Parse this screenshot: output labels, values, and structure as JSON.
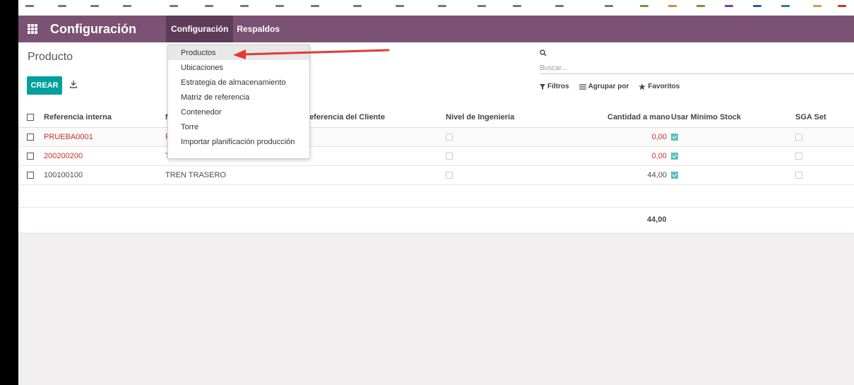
{
  "navbar": {
    "app_title": "Configuración",
    "menu": [
      {
        "label": "Configuración",
        "active": true
      },
      {
        "label": "Respaldos",
        "active": false
      }
    ],
    "background": "#7c5274"
  },
  "control_panel": {
    "title": "Producto",
    "create_label": "CREAR",
    "search_placeholder": "Buscar...",
    "filters_label": "Filtros",
    "group_by_label": "Agrupar por",
    "favorites_label": "Favoritos"
  },
  "dropdown": {
    "items": [
      "Productos",
      "Ubicaciones",
      "Estrategia de almacenamiento",
      "Matriz de referencia",
      "Contenedor",
      "Torre",
      "Importar planificación producción"
    ],
    "highlighted": "Productos"
  },
  "table": {
    "headers": [
      "Referencia interna",
      "N",
      "Referencia del Cliente",
      "Nivel de Ingeniería",
      "Cantidad a mano",
      "Usar Mínimo Stock",
      "SGA Set"
    ],
    "rows": [
      {
        "ref": "PRUEBA0001",
        "name": "P",
        "qty": "0,00",
        "min_stock": true,
        "sga": false,
        "red": true
      },
      {
        "ref": "200200200",
        "name": "TREN DELANTERO",
        "qty": "0,00",
        "min_stock": true,
        "sga": false,
        "red": true
      },
      {
        "ref": "100100100",
        "name": "TREN TRASERO",
        "qty": "44,00",
        "min_stock": true,
        "sga": false,
        "red": false
      }
    ],
    "total_qty": "44,00"
  },
  "colors": {
    "accent": "#00a09d",
    "danger_text": "#c9302c",
    "checkbox_checked": "#5bc0c5",
    "annotation_arrow": "#e53935"
  }
}
